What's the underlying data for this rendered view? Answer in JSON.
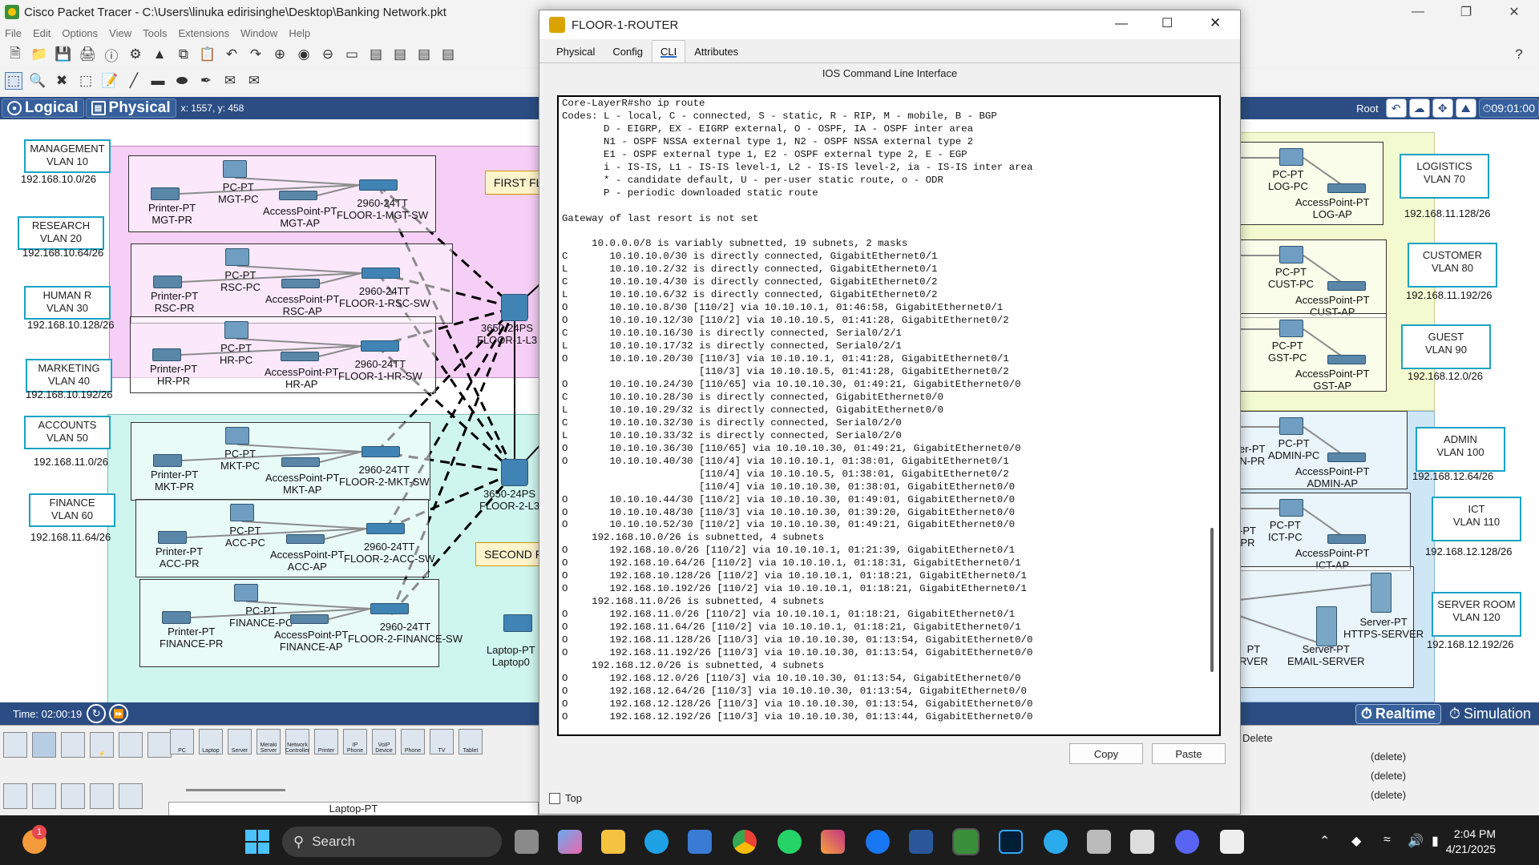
{
  "app": {
    "title": "Cisco Packet Tracer - C:\\Users\\linuka edirisinghe\\Desktop\\Banking Network.pkt",
    "menu": [
      "File",
      "Edit",
      "Options",
      "View",
      "Tools",
      "Extensions",
      "Window",
      "Help"
    ],
    "nav": {
      "logical": "Logical",
      "physical": "Physical",
      "coords": "x: 1557, y: 458",
      "root": "Root",
      "time": "09:01:00"
    },
    "status": {
      "time": "Time: 02:00:19",
      "realtime": "Realtime",
      "simulation": "Simulation"
    },
    "bottom": {
      "selected_device": "Laptop-PT",
      "delete_header": "Delete",
      "delete_rows": [
        "(delete)",
        "(delete)",
        "(delete)"
      ],
      "devices": [
        "PC",
        "Laptop",
        "Server",
        "Meraki Server",
        "Network Controller",
        "Printer",
        "IP Phone",
        "VoIP Device",
        "Phone",
        "TV",
        "Tablet"
      ]
    }
  },
  "topology": {
    "left_vlans": [
      {
        "name": "MANAGEMENT\nVLAN 10",
        "subnet": "192.168.10.0/26"
      },
      {
        "name": "RESEARCH\nVLAN 20",
        "subnet": "192.168.10.64/26"
      },
      {
        "name": "HUMAN R\nVLAN 30",
        "subnet": "192.168.10.128/26"
      },
      {
        "name": "MARKETING\nVLAN 40",
        "subnet": "192.168.10.192/26"
      },
      {
        "name": "ACCOUNTS\nVLAN 50",
        "subnet": "192.168.11.0/26"
      },
      {
        "name": "FINANCE\nVLAN 60",
        "subnet": "192.168.11.64/26"
      }
    ],
    "right_vlans": [
      {
        "name": "LOGISTICS\nVLAN 70",
        "subnet": "192.168.11.128/26"
      },
      {
        "name": "CUSTOMER\nVLAN 80",
        "subnet": "192.168.11.192/26"
      },
      {
        "name": "GUEST\nVLAN 90",
        "subnet": "192.168.12.0/26"
      },
      {
        "name": "ADMIN\nVLAN 100",
        "subnet": "192.168.12.64/26"
      },
      {
        "name": "ICT\nVLAN 110",
        "subnet": "192.168.12.128/26"
      },
      {
        "name": "SERVER ROOM\nVLAN 120",
        "subnet": "192.168.12.192/26"
      }
    ],
    "groups": [
      {
        "printer": "Printer-PT\nMGT-PR",
        "pc": "PC-PT\nMGT-PC",
        "ap": "AccessPoint-PT\nMGT-AP",
        "sw": "2960-24TT\nFLOOR-1-MGT-SW"
      },
      {
        "printer": "Printer-PT\nRSC-PR",
        "pc": "PC-PT\nRSC-PC",
        "ap": "AccessPoint-PT\nRSC-AP",
        "sw": "2960-24TT\nFLOOR-1-RSC-SW"
      },
      {
        "printer": "Printer-PT\nHR-PR",
        "pc": "PC-PT\nHR-PC",
        "ap": "AccessPoint-PT\nHR-AP",
        "sw": "2960-24TT\nFLOOR-1-HR-SW"
      },
      {
        "printer": "Printer-PT\nMKT-PR",
        "pc": "PC-PT\nMKT-PC",
        "ap": "AccessPoint-PT\nMKT-AP",
        "sw": "2960-24TT\nFLOOR-2-MKT-SW"
      },
      {
        "printer": "Printer-PT\nACC-PR",
        "pc": "PC-PT\nACC-PC",
        "ap": "AccessPoint-PT\nACC-AP",
        "sw": "2960-24TT\nFLOOR-2-ACC-SW"
      },
      {
        "printer": "Printer-PT\nFINANCE-PR",
        "pc": "PC-PT\nFINANCE-PC",
        "ap": "AccessPoint-PT\nFINANCE-AP",
        "sw": "2960-24TT\nFLOOR-2-FINANCE-SW"
      }
    ],
    "right_groups": [
      {
        "pc": "PC-PT\nLOG-PC",
        "ap": "AccessPoint-PT\nLOG-AP"
      },
      {
        "pc": "PC-PT\nCUST-PC",
        "ap": "AccessPoint-PT\nCUST-AP"
      },
      {
        "pc": "PC-PT\nGST-PC",
        "ap": "AccessPoint-PT\nGST-AP"
      },
      {
        "pc": "PC-PT\nADMIN-PC",
        "ap": "AccessPoint-PT\nADMIN-AP",
        "printer": "er-PT\nN-PR"
      },
      {
        "pc": "PC-PT\nICT-PC",
        "ap": "AccessPoint-PT\nICT-AP",
        "printer": "-PT\nPR"
      },
      {
        "server1": "Server-PT\nHTTPS-SERVER",
        "server2": "Server-PT\nEMAIL-SERVER",
        "server3": "PT\nRVER"
      }
    ],
    "l3": [
      {
        "label": "3650-24PS\nFLOOR-1-L3"
      },
      {
        "label": "3650-24PS\nFLOOR-2-L3"
      }
    ],
    "floor_labels": [
      "FIRST FL",
      "SECOND F"
    ],
    "laptop": "Laptop-PT\nLaptop0"
  },
  "dialog": {
    "title": "FLOOR-1-ROUTER",
    "tabs": [
      "Physical",
      "Config",
      "CLI",
      "Attributes"
    ],
    "active_tab": "CLI",
    "cli_header": "IOS Command Line Interface",
    "cli_lines": [
      "Core-LayerR#sho ip route",
      "Codes: L - local, C - connected, S - static, R - RIP, M - mobile, B - BGP",
      "       D - EIGRP, EX - EIGRP external, O - OSPF, IA - OSPF inter area",
      "       N1 - OSPF NSSA external type 1, N2 - OSPF NSSA external type 2",
      "       E1 - OSPF external type 1, E2 - OSPF external type 2, E - EGP",
      "       i - IS-IS, L1 - IS-IS level-1, L2 - IS-IS level-2, ia - IS-IS inter area",
      "       * - candidate default, U - per-user static route, o - ODR",
      "       P - periodic downloaded static route",
      "",
      "Gateway of last resort is not set",
      "",
      "     10.0.0.0/8 is variably subnetted, 19 subnets, 2 masks",
      "C       10.10.10.0/30 is directly connected, GigabitEthernet0/1",
      "L       10.10.10.2/32 is directly connected, GigabitEthernet0/1",
      "C       10.10.10.4/30 is directly connected, GigabitEthernet0/2",
      "L       10.10.10.6/32 is directly connected, GigabitEthernet0/2",
      "O       10.10.10.8/30 [110/2] via 10.10.10.1, 01:46:58, GigabitEthernet0/1",
      "O       10.10.10.12/30 [110/2] via 10.10.10.5, 01:41:28, GigabitEthernet0/2",
      "C       10.10.10.16/30 is directly connected, Serial0/2/1",
      "L       10.10.10.17/32 is directly connected, Serial0/2/1",
      "O       10.10.10.20/30 [110/3] via 10.10.10.1, 01:41:28, GigabitEthernet0/1",
      "                       [110/3] via 10.10.10.5, 01:41:28, GigabitEthernet0/2",
      "O       10.10.10.24/30 [110/65] via 10.10.10.30, 01:49:21, GigabitEthernet0/0",
      "C       10.10.10.28/30 is directly connected, GigabitEthernet0/0",
      "L       10.10.10.29/32 is directly connected, GigabitEthernet0/0",
      "C       10.10.10.32/30 is directly connected, Serial0/2/0",
      "L       10.10.10.33/32 is directly connected, Serial0/2/0",
      "O       10.10.10.36/30 [110/65] via 10.10.10.30, 01:49:21, GigabitEthernet0/0",
      "O       10.10.10.40/30 [110/4] via 10.10.10.1, 01:38:01, GigabitEthernet0/1",
      "                       [110/4] via 10.10.10.5, 01:38:01, GigabitEthernet0/2",
      "                       [110/4] via 10.10.10.30, 01:38:01, GigabitEthernet0/0",
      "O       10.10.10.44/30 [110/2] via 10.10.10.30, 01:49:01, GigabitEthernet0/0",
      "O       10.10.10.48/30 [110/3] via 10.10.10.30, 01:39:20, GigabitEthernet0/0",
      "O       10.10.10.52/30 [110/2] via 10.10.10.30, 01:49:21, GigabitEthernet0/0",
      "     192.168.10.0/26 is subnetted, 4 subnets",
      "O       192.168.10.0/26 [110/2] via 10.10.10.1, 01:21:39, GigabitEthernet0/1",
      "O       192.168.10.64/26 [110/2] via 10.10.10.1, 01:18:31, GigabitEthernet0/1",
      "O       192.168.10.128/26 [110/2] via 10.10.10.1, 01:18:21, GigabitEthernet0/1",
      "O       192.168.10.192/26 [110/2] via 10.10.10.1, 01:18:21, GigabitEthernet0/1",
      "     192.168.11.0/26 is subnetted, 4 subnets",
      "O       192.168.11.0/26 [110/2] via 10.10.10.1, 01:18:21, GigabitEthernet0/1",
      "O       192.168.11.64/26 [110/2] via 10.10.10.1, 01:18:21, GigabitEthernet0/1",
      "O       192.168.11.128/26 [110/3] via 10.10.10.30, 01:13:54, GigabitEthernet0/0",
      "O       192.168.11.192/26 [110/3] via 10.10.10.30, 01:13:54, GigabitEthernet0/0",
      "     192.168.12.0/26 is subnetted, 4 subnets",
      "O       192.168.12.0/26 [110/3] via 10.10.10.30, 01:13:54, GigabitEthernet0/0",
      "O       192.168.12.64/26 [110/3] via 10.10.10.30, 01:13:54, GigabitEthernet0/0",
      "O       192.168.12.128/26 [110/3] via 10.10.10.30, 01:13:54, GigabitEthernet0/0",
      "O       192.168.12.192/26 [110/3] via 10.10.10.30, 01:13:44, GigabitEthernet0/0"
    ],
    "copy": "Copy",
    "paste": "Paste",
    "top_checkbox": "Top"
  },
  "taskbar": {
    "search": "Search",
    "time": "2:04 PM",
    "date": "4/21/2025",
    "notification_count": "1"
  }
}
